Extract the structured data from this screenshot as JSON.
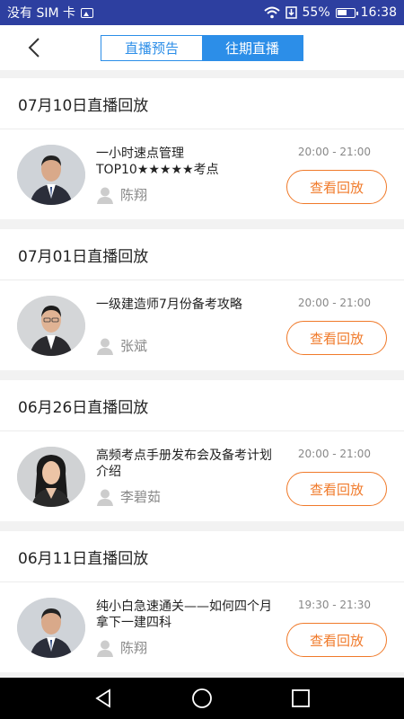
{
  "status": {
    "carrier": "没有 SIM 卡",
    "battery_percent": "55%",
    "time": "16:38"
  },
  "header": {
    "tabs": [
      {
        "label": "直播预告",
        "active": false
      },
      {
        "label": "往期直播",
        "active": true
      }
    ]
  },
  "button_label": "查看回放",
  "sessions": [
    {
      "date_title": "07月10日直播回放",
      "title": "一小时速点管理TOP10★★★★★考点",
      "teacher": "陈翔",
      "time": "20:00 - 21:00"
    },
    {
      "date_title": "07月01日直播回放",
      "title": "一级建造师7月份备考攻略",
      "teacher": "张斌",
      "time": "20:00 - 21:00"
    },
    {
      "date_title": "06月26日直播回放",
      "title": "高频考点手册发布会及备考计划介绍",
      "teacher": "李碧茹",
      "time": "20:00 - 21:00"
    },
    {
      "date_title": "06月11日直播回放",
      "title": "纯小白急速通关——如何四个月拿下一建四科",
      "teacher": "陈翔",
      "time": "19:30 - 21:30"
    }
  ],
  "icons": {
    "back": "chevron-left-icon",
    "person": "person-icon",
    "nav_back": "triangle-back-icon",
    "nav_home": "circle-home-icon",
    "nav_recent": "square-recent-icon"
  }
}
